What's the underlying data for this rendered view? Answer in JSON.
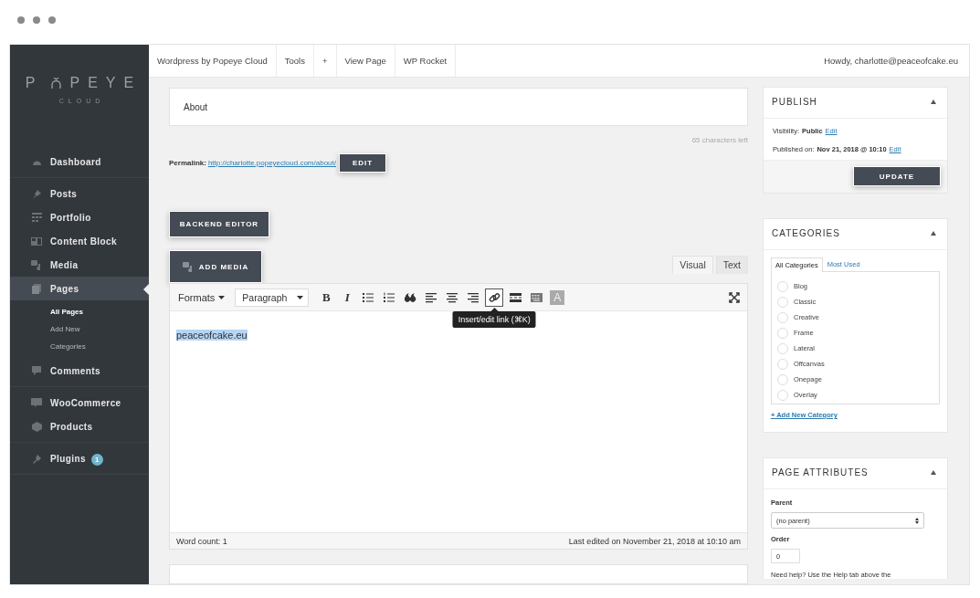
{
  "logo": {
    "before": "P",
    "after": "PEYE",
    "sub": "CLOUD"
  },
  "sidebar": {
    "sections": [
      {
        "items": [
          {
            "label": "Dashboard",
            "selected": false
          }
        ]
      },
      {
        "items": [
          {
            "label": "Posts",
            "selected": false
          },
          {
            "label": "Portfolio",
            "selected": false
          },
          {
            "label": "Content Block",
            "selected": false
          },
          {
            "label": "Media",
            "selected": false
          },
          {
            "label": "Pages",
            "selected": true,
            "children": [
              {
                "label": "All Pages",
                "selected": true
              },
              {
                "label": "Add New",
                "selected": false
              },
              {
                "label": "Categories",
                "selected": false
              }
            ]
          },
          {
            "label": "Comments",
            "selected": false
          }
        ]
      },
      {
        "items": [
          {
            "label": "WooCommerce",
            "selected": false
          },
          {
            "label": "Products",
            "selected": false
          }
        ]
      },
      {
        "items": [
          {
            "label": "Plugins",
            "selected": false,
            "badge": "1"
          }
        ]
      }
    ]
  },
  "topbar": {
    "items": [
      "Wordpress by Popeye Cloud",
      "Tools",
      "+",
      "View Page",
      "WP Rocket"
    ],
    "greeting": "Howdy, charlotte@peaceofcake.eu"
  },
  "editor": {
    "title": "About",
    "chars_left": "65 characters left",
    "permalink": {
      "label": "Permalink:",
      "url": "http://charlotte.popeyecloud.com/about/",
      "button": "EDIT"
    },
    "backend_button": "BACKEND EDITOR",
    "media_button": "ADD MEDIA",
    "tabs": [
      {
        "label": "Visual",
        "selected": true
      },
      {
        "label": "Text",
        "selected": false
      }
    ],
    "formats": "Formats",
    "block_format": "Paragraph",
    "tools": [
      {
        "kind": "bold",
        "label": "B",
        "active": false
      },
      {
        "kind": "italic",
        "label": "I",
        "active": false
      },
      {
        "kind": "bullet-list",
        "active": false
      },
      {
        "kind": "numbered-list",
        "active": false
      },
      {
        "kind": "blockquote",
        "active": false
      },
      {
        "kind": "align-left",
        "active": false
      },
      {
        "kind": "align-center",
        "active": false
      },
      {
        "kind": "align-right",
        "active": false
      },
      {
        "kind": "link",
        "active": true
      },
      {
        "kind": "read-more",
        "active": false
      },
      {
        "kind": "keyboard",
        "active": false
      },
      {
        "kind": "text-color",
        "label": "A",
        "active": false
      }
    ],
    "tooltip": "Insert/edit link (⌘K)",
    "content": "peaceofcake.eu",
    "word_count": "Word count: 1",
    "last_edited": "Last edited on November 21, 2018 at 10:10 am"
  },
  "publish": {
    "title": "PUBLISH",
    "rows": [
      {
        "label": "Visibility:",
        "value": "Public",
        "link": "Edit"
      },
      {
        "label": "Published on:",
        "value": "Nov 21, 2018 @ 10:10",
        "link": "Edit"
      }
    ],
    "button": "UPDATE"
  },
  "categories": {
    "title": "CATEGORIES",
    "tabs": [
      {
        "label": "All Categories",
        "selected": true
      },
      {
        "label": "Most Used",
        "selected": false
      }
    ],
    "items": [
      {
        "label": "Blog",
        "checked": false
      },
      {
        "label": "Classic",
        "checked": false
      },
      {
        "label": "Creative",
        "checked": false
      },
      {
        "label": "Frame",
        "checked": false
      },
      {
        "label": "Lateral",
        "checked": false
      },
      {
        "label": "Offcanvas",
        "checked": false
      },
      {
        "label": "Onepage",
        "checked": false
      },
      {
        "label": "Overlay",
        "checked": false
      }
    ],
    "add_link": "+ Add New Category"
  },
  "page_attributes": {
    "title": "PAGE ATTRIBUTES",
    "parent_label": "Parent",
    "parent_value": "(no parent)",
    "order_label": "Order",
    "order_value": "0",
    "help": "Need help? Use the Help tab above the"
  }
}
